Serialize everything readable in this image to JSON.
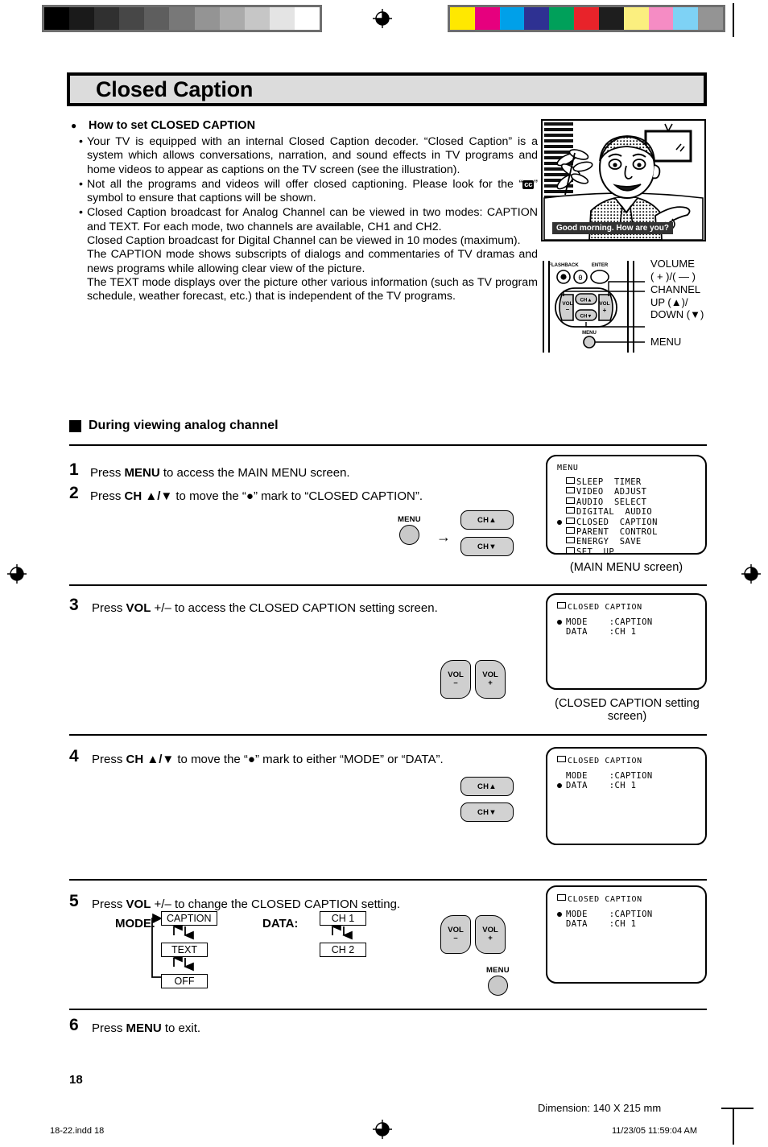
{
  "page": {
    "number": "18",
    "dimension_note": "Dimension: 140  X 215 mm",
    "file_note": "18-22.indd   18",
    "timestamp": "11/23/05   11:59:04 AM"
  },
  "title": "Closed Caption",
  "intro": {
    "heading": "How to set CLOSED CAPTION",
    "bullet1_a": "Your TV is equipped with an internal Closed Caption decoder. “Closed Caption” is a system which allows conversations, narration, and sound effects in TV programs and home videos to appear as captions on the TV screen (see the illustration).",
    "bullet2_a": "Not all the programs and videos will offer closed captioning. Please look for the “",
    "bullet2_icon": "cc",
    "bullet2_b": "” symbol to ensure that captions will be shown.",
    "bullet3_a": "Closed Caption broadcast for Analog Channel can be viewed in two modes: CAPTION and TEXT. For each mode, two channels are available, CH1 and CH2.",
    "bullet3_b": "Closed Caption broadcast for Digital Channel can be viewed in 10 modes (maximum).",
    "bullet3_c": "The CAPTION mode shows subscripts of dialogs and commentaries of TV dramas and news programs while allowing clear view of the picture.",
    "bullet3_d": "The TEXT mode displays over the picture other various information (such as TV program schedule, weather forecast, etc.) that is independent of the TV programs."
  },
  "illustration": {
    "caption_text": "Good morning. How are you?"
  },
  "remote_diagram": {
    "flashback_label": "FLASHBACK",
    "enter_label": "ENTER",
    "zero_label": "0",
    "vol_minus": "VOL",
    "vol_minus_sign": "–",
    "vol_plus": "VOL",
    "vol_plus_sign": "+",
    "ch_up": "CH▲",
    "ch_down": "CH▼",
    "menu": "MENU",
    "callout_volume_line1": "VOLUME",
    "callout_volume_line2": "( + )/( — )",
    "callout_channel_line1": "CHANNEL",
    "callout_channel_line2": "UP (▲)/",
    "callout_channel_line3": "DOWN (▼)",
    "callout_menu": "MENU"
  },
  "section_heading": "During viewing analog channel",
  "steps": [
    {
      "num": "1",
      "text_parts": [
        "Press ",
        "MENU",
        " to access the MAIN MENU screen."
      ]
    },
    {
      "num": "2",
      "text_parts": [
        "Press ",
        "CH ▲/▼",
        " to move the “●” mark to “CLOSED CAPTION”."
      ]
    },
    {
      "num": "3",
      "text_parts": [
        "Press ",
        "VOL",
        "  +/–  to access the CLOSED CAPTION setting screen."
      ]
    },
    {
      "num": "4",
      "text_parts": [
        "Press ",
        "CH ▲/▼",
        " to move the “●” mark to either “MODE” or “DATA”."
      ]
    },
    {
      "num": "5",
      "text_parts": [
        "Press ",
        "VOL",
        "  +/–  to change the CLOSED CAPTION setting."
      ]
    },
    {
      "num": "6",
      "text_parts": [
        "Press ",
        "MENU",
        " to exit."
      ]
    }
  ],
  "main_menu_screen": {
    "title": "MENU",
    "items": [
      {
        "label": "SLEEP TIMER",
        "selected": false
      },
      {
        "label": "VIDEO ADJUST",
        "selected": false
      },
      {
        "label": "AUDIO SELECT",
        "selected": false
      },
      {
        "label": "DIGITAL AUDIO",
        "selected": false
      },
      {
        "label": "CLOSED CAPTION",
        "selected": true
      },
      {
        "label": "PARENT CONTROL",
        "selected": false
      },
      {
        "label": "ENERGY SAVE",
        "selected": false
      },
      {
        "label": "SET UP",
        "selected": false
      }
    ],
    "caption": "(MAIN  MENU  screen)"
  },
  "cc_screen_step3": {
    "title": "CLOSED CAPTION",
    "rows": [
      {
        "label": "MODE",
        "value": ":CAPTION",
        "selected": true
      },
      {
        "label": "DATA",
        "value": ":CH 1",
        "selected": false
      }
    ],
    "caption": "(CLOSED CAPTION setting screen)"
  },
  "cc_screen_step4": {
    "title": "CLOSED CAPTION",
    "rows": [
      {
        "label": "MODE",
        "value": ":CAPTION",
        "selected": false
      },
      {
        "label": "DATA",
        "value": ":CH 1",
        "selected": true
      }
    ]
  },
  "cc_screen_step5": {
    "title": "CLOSED CAPTION",
    "rows": [
      {
        "label": "MODE",
        "value": ":CAPTION",
        "selected": true
      },
      {
        "label": "DATA",
        "value": ":CH 1",
        "selected": false
      }
    ]
  },
  "step5_flow": {
    "mode_label": "MODE:",
    "mode_options": [
      "CAPTION",
      "TEXT",
      "OFF"
    ],
    "data_label": "DATA:",
    "data_options": [
      "CH 1",
      "CH 2"
    ]
  },
  "calibration": {
    "gray_steps": [
      "#000000",
      "#1a1a1a",
      "#303030",
      "#474747",
      "#5e5e5e",
      "#787878",
      "#949494",
      "#ababab",
      "#c6c6c6",
      "#e4e4e4",
      "#ffffff"
    ],
    "color_patches": [
      "#ffe800",
      "#e6007e",
      "#00a0e9",
      "#2e3192",
      "#00a05a",
      "#e8232a",
      "#1e1e1e",
      "#fbef7f",
      "#f58cc4",
      "#7ed2f5",
      "#949494"
    ]
  }
}
